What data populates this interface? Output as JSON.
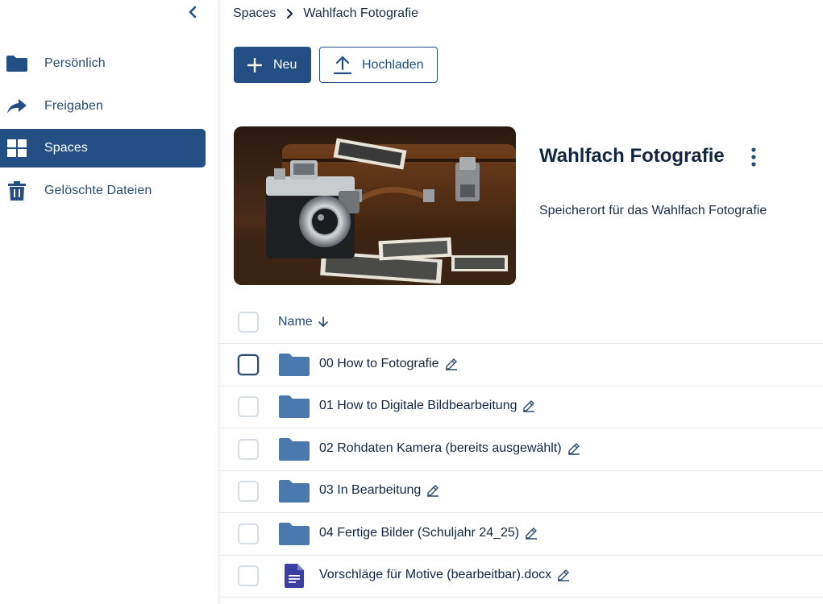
{
  "sidebar": {
    "items": [
      {
        "label": "Persönlich",
        "icon": "folder-icon"
      },
      {
        "label": "Freigaben",
        "icon": "share-icon"
      },
      {
        "label": "Spaces",
        "icon": "spaces-grid-icon",
        "active": true
      },
      {
        "label": "Gelöschte Dateien",
        "icon": "trash-icon"
      }
    ]
  },
  "breadcrumb": {
    "root": "Spaces",
    "current": "Wahlfach Fotografie"
  },
  "toolbar": {
    "new_label": "Neu",
    "upload_label": "Hochladen"
  },
  "space": {
    "title": "Wahlfach Fotografie",
    "description": "Speicherort für das Wahlfach Fotografie"
  },
  "table": {
    "name_header": "Name",
    "sort": "descending",
    "rows": [
      {
        "name": "00 How to Fotografie",
        "type": "folder"
      },
      {
        "name": "01 How to Digitale Bildbearbeitung",
        "type": "folder"
      },
      {
        "name": "02 Rohdaten Kamera (bereits ausgewählt)",
        "type": "folder"
      },
      {
        "name": "03 In Bearbeitung",
        "type": "folder"
      },
      {
        "name": "04 Fertige Bilder (Schuljahr 24_25)",
        "type": "folder"
      },
      {
        "name": "Vorschläge für Motive (bearbeitbar).docx",
        "type": "docx"
      }
    ]
  },
  "colors": {
    "accent": "#234f84",
    "folder": "#4a79ad",
    "doc": "#3a3fa0",
    "text": "#122640"
  }
}
